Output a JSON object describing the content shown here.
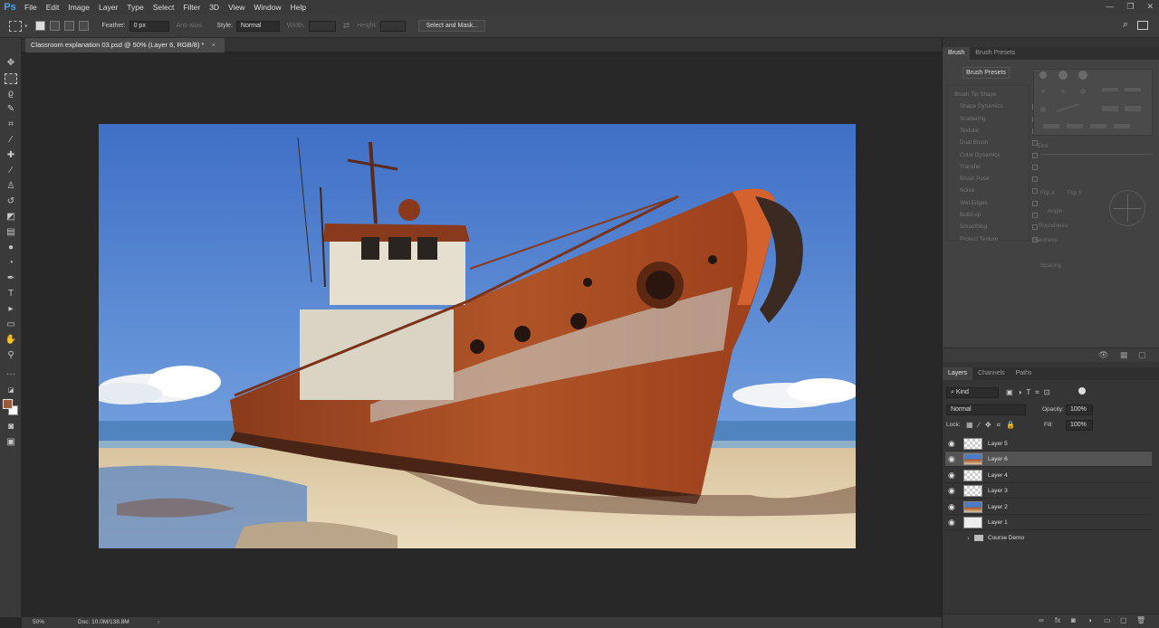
{
  "app": {
    "logo": "Ps"
  },
  "menubar": [
    "File",
    "Edit",
    "Image",
    "Layer",
    "Type",
    "Select",
    "Filter",
    "3D",
    "View",
    "Window",
    "Help"
  ],
  "window_controls": {
    "minimize": "—",
    "restore": "❐",
    "close": "✕"
  },
  "options": {
    "feather_label": "Feather:",
    "feather_value": "0 px",
    "antialias_label": "Anti-alias",
    "style_label": "Style:",
    "style_value": "Normal",
    "width_label": "Width:",
    "height_label": "Height:",
    "select_mask_label": "Select and Mask..."
  },
  "document": {
    "tab_title": "Classroom explanation 03.psd @ 50% (Layer 6, RGB/8) *",
    "zoom": "50%",
    "doc_size": "Doc: 10.0M/138.8M"
  },
  "colors": {
    "foreground": "#9b5a3c",
    "background": "#ffffff",
    "accent": "#4aa3f0"
  },
  "brush_panel": {
    "tabs": [
      "Brush",
      "Brush Presets"
    ],
    "presets_button": "Brush Presets",
    "items": [
      "Brush Tip Shape",
      "Shape Dynamics",
      "Scattering",
      "Texture",
      "Dual Brush",
      "Color Dynamics",
      "Transfer",
      "Brush Pose",
      "Noise",
      "Wet Edges",
      "Build-up",
      "Smoothing",
      "Protect Texture"
    ],
    "size_label": "Size",
    "flip_x": "Flip X",
    "flip_y": "Flip Y",
    "angle_label": "Angle:",
    "roundness_label": "Roundness:",
    "hardness_label": "Hardness",
    "spacing_label": "Spacing"
  },
  "layers_panel": {
    "tabs": [
      "Layers",
      "Channels",
      "Paths"
    ],
    "kind_label": "Kind",
    "blend_mode": "Normal",
    "opacity_label": "Opacity:",
    "opacity_value": "100%",
    "lock_label": "Lock:",
    "fill_label": "Fill:",
    "fill_value": "100%",
    "layers": [
      {
        "name": "Layer 5",
        "thumb": "checker",
        "selected": false
      },
      {
        "name": "Layer 6",
        "thumb": "image",
        "selected": true
      },
      {
        "name": "Layer 4",
        "thumb": "checker",
        "selected": false
      },
      {
        "name": "Layer 3",
        "thumb": "checker",
        "selected": false
      },
      {
        "name": "Layer 2",
        "thumb": "image",
        "selected": false
      },
      {
        "name": "Layer 1",
        "thumb": "white",
        "selected": false
      }
    ],
    "group_name": "Course Demo"
  }
}
